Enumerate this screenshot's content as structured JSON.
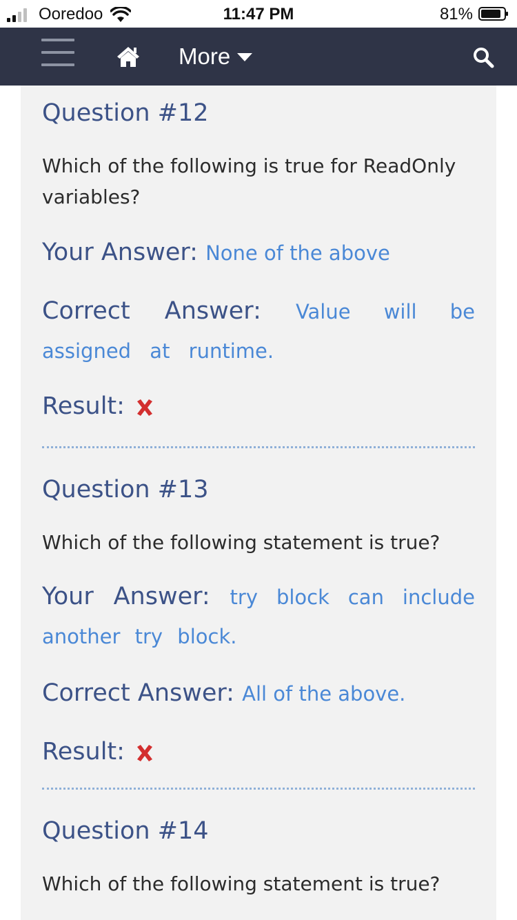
{
  "status_bar": {
    "carrier": "Ooredoo",
    "time": "11:47 PM",
    "battery": "81%"
  },
  "nav": {
    "menu_label": "More",
    "icons": [
      "hamburger-icon",
      "home-icon",
      "chevron-down-icon",
      "search-icon"
    ]
  },
  "colors": {
    "navbar_bg": "#2f3447",
    "title_blue": "#3c5287",
    "answer_blue": "#4a88d6",
    "wrong_red": "#d32f2f",
    "panel_bg": "#f2f2f2"
  },
  "questions": [
    {
      "title": "Question #12",
      "text": "Which of the following is true for ReadOnly variables?",
      "your_answer_label": "Your Answer:",
      "your_answer": "None of the above",
      "correct_answer_label": "Correct Answer:",
      "correct_answer": "Value will be assigned at runtime.",
      "result_label": "Result:",
      "result_icon": "cross-icon"
    },
    {
      "title": "Question #13",
      "text": "Which of the following statement is true?",
      "your_answer_label": "Your Answer:",
      "your_answer": "try block can include another try block.",
      "correct_answer_label": "Correct Answer:",
      "correct_answer": "All of the above.",
      "result_label": "Result:",
      "result_icon": "cross-icon"
    },
    {
      "title": "Question #14",
      "text": "Which of the following statement is true?"
    }
  ]
}
